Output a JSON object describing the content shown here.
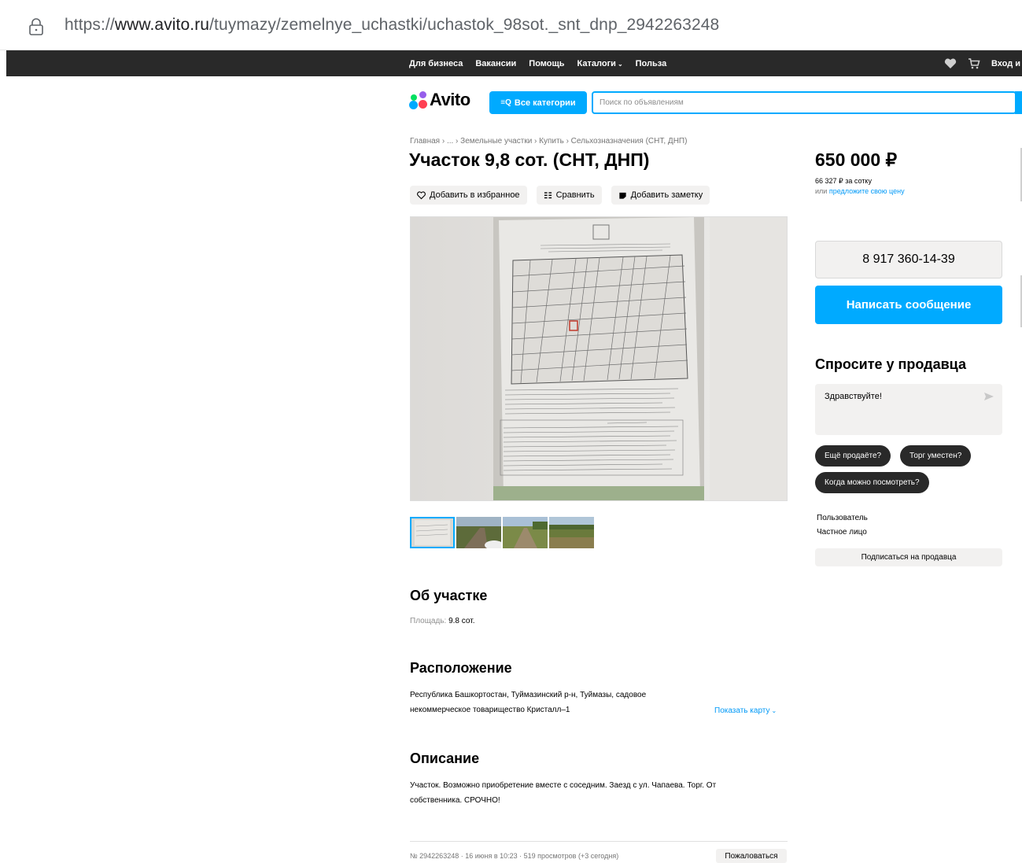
{
  "browser": {
    "url_prefix": "https://",
    "url_host": "www.avito.ru",
    "url_path": "/tuymazy/zemelnye_uchastki/uchastok_98sot._snt_dnp_2942263248"
  },
  "topnav": {
    "links": [
      "Для бизнеса",
      "Вакансии",
      "Помощь",
      "Каталоги",
      "Польза"
    ],
    "login": "Вход и р"
  },
  "header": {
    "logo": "Avito",
    "categories_button": "Все категории",
    "search_placeholder": "Поиск по объявлениям"
  },
  "breadcrumbs": "Главная › ... › Земельные участки › Купить › Сельхозназначения (СНТ, ДНП)",
  "listing": {
    "title": "Участок 9,8 сот. (СНТ, ДНП)",
    "actions": {
      "favorite": "Добавить в избранное",
      "compare": "Сравнить",
      "note": "Добавить заметку"
    },
    "about_heading": "Об участке",
    "area_label": "Площадь:",
    "area_value": "9.8 сот.",
    "location_heading": "Расположение",
    "address_line1": "Республика Башкортостан, Туймазинский р-н, Туймазы, садовое",
    "address_line2": "некоммерческое товарищество Кристалл–1",
    "show_map": "Показать карту",
    "description_heading": "Описание",
    "description_line1": "Участок. Возможно приобретение вместе с соседним. Заезд с ул. Чапаева. Торг. От",
    "description_line2": "собственника. СРОЧНО!",
    "footer_meta": "№ 2942263248 · 16 июня в 10:23 · 519 просмотров (+3 сегодня)",
    "complain": "Пожаловаться"
  },
  "sidebar": {
    "price": "650 000 ₽",
    "per_sotka": "66 327 ₽ за сотку",
    "offer_prefix": "или",
    "offer_link": "предложите свою цену",
    "phone": "8 917 360-14-39",
    "write_message": "Написать сообщение",
    "ask_heading": "Спросите у продавца",
    "chat_placeholder": "Здравствуйте!",
    "quick_questions": [
      "Ещё продаёте?",
      "Торг уместен?",
      "Когда можно посмотреть?"
    ],
    "seller_name": "Пользователь",
    "seller_type": "Частное лицо",
    "subscribe": "Подписаться на продавца"
  },
  "colors": {
    "accent": "#00aaff",
    "nav_bg": "#292929",
    "button_bg": "#f2f1f0"
  }
}
